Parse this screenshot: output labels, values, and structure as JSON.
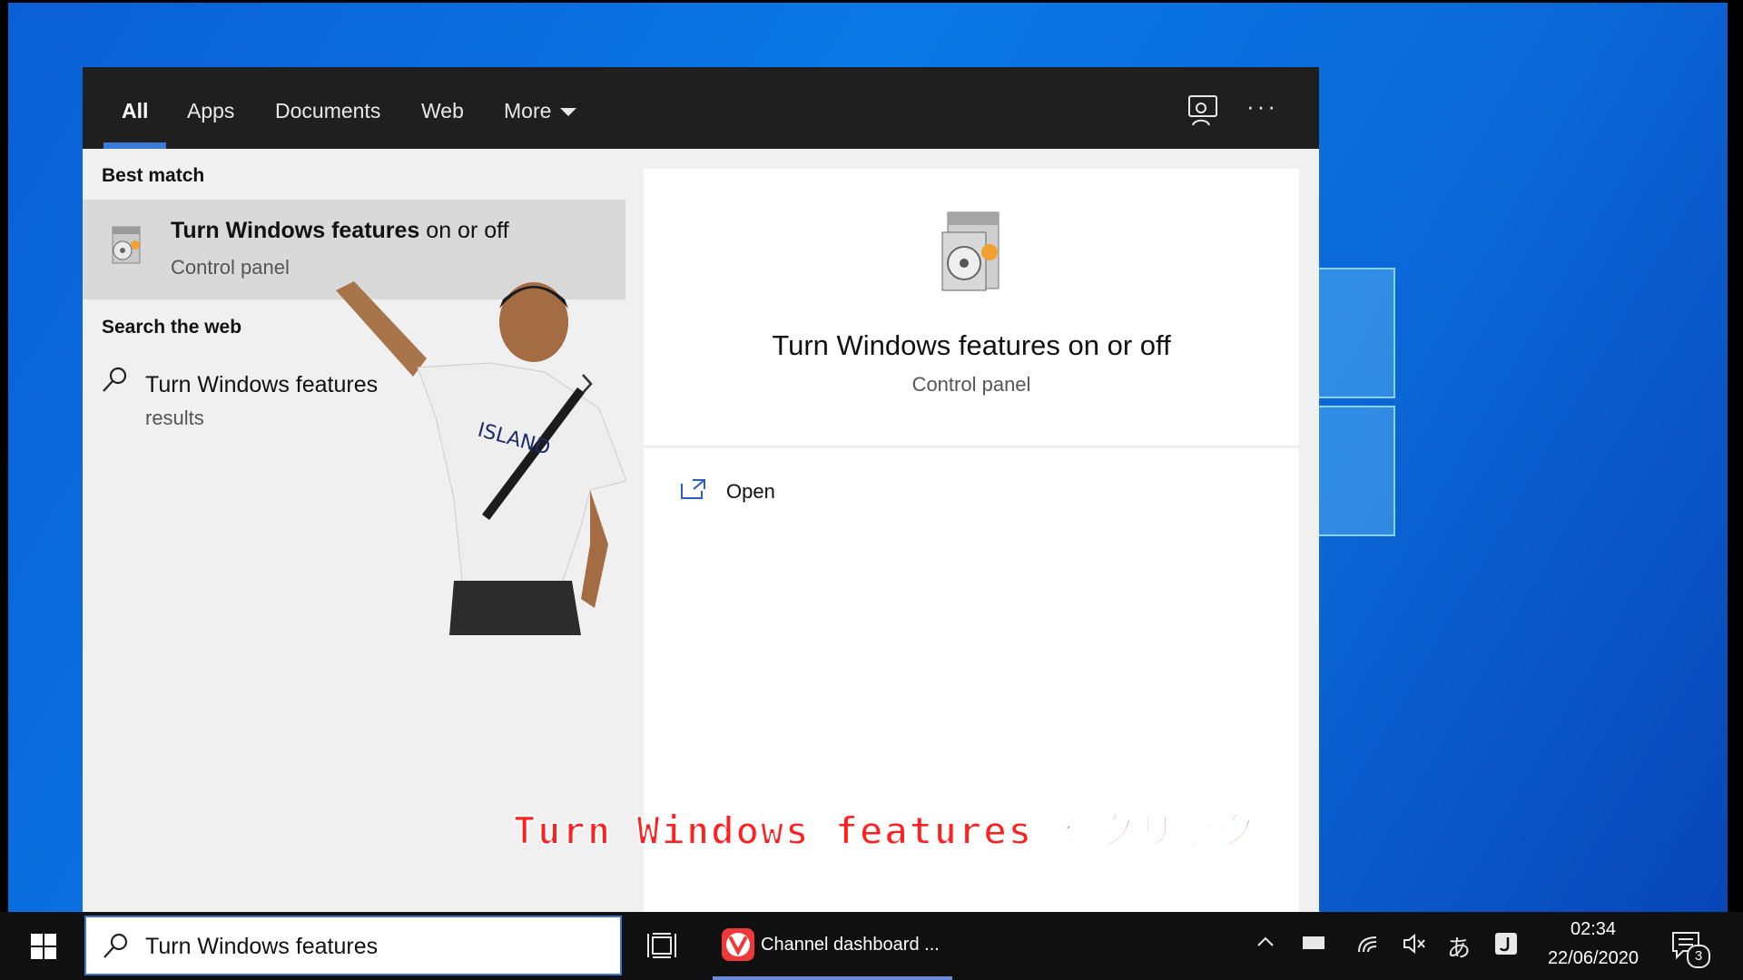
{
  "tabs": [
    {
      "label": "All"
    },
    {
      "label": "Apps"
    },
    {
      "label": "Documents"
    },
    {
      "label": "Web"
    },
    {
      "label": "More"
    }
  ],
  "sections": {
    "best_match": "Best match",
    "search_web": "Search the web"
  },
  "best_match_item": {
    "title_bold": "Turn Windows features",
    "title_rest": " on or off",
    "subtitle": "Control panel"
  },
  "web_item": {
    "title": "Turn Windows features",
    "subtitle": "results"
  },
  "preview": {
    "title": "Turn Windows features on or off",
    "subtitle": "Control panel",
    "open_label": "Open"
  },
  "caption": "Turn Windows features をクリック",
  "taskbar": {
    "search_value": "Turn Windows features",
    "app_label": "Channel dashboard ...",
    "ime": "あ",
    "time": "02:34",
    "date": "22/06/2020",
    "notification_count": "3"
  },
  "colors": {
    "accent": "#3b7bd8",
    "tabbar_bg": "#1f1f1f",
    "caption_red": "#ff2020"
  }
}
